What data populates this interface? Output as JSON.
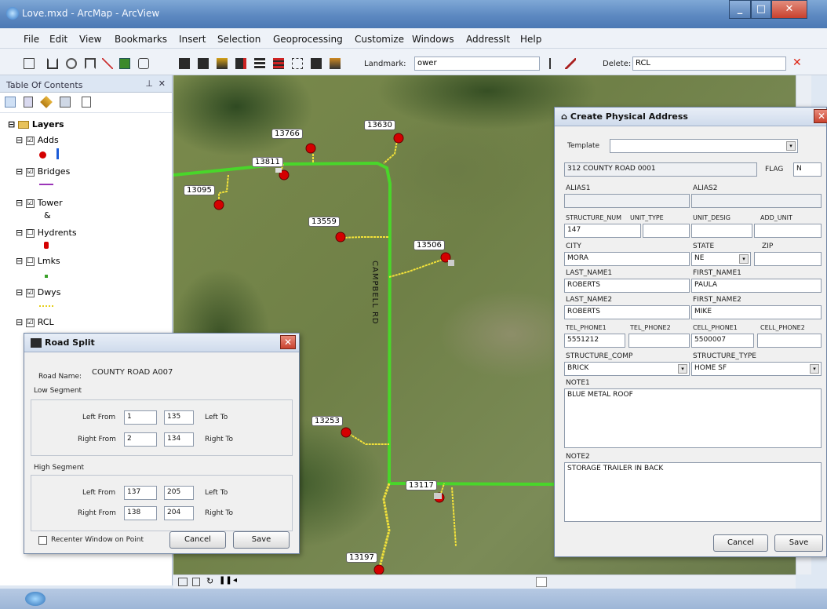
{
  "window": {
    "title": "Love.mxd - ArcMap - ArcView"
  },
  "menu": [
    "File",
    "Edit",
    "View",
    "Bookmarks",
    "Insert",
    "Selection",
    "Geoprocessing",
    "Customize",
    "Windows",
    "AddressIt",
    "Help"
  ],
  "toolbar": {
    "landmark_label": "Landmark:",
    "landmark_value": "ower",
    "delete_label": "Delete:",
    "delete_value": "RCL"
  },
  "toc": {
    "title": "Table Of Contents",
    "root": "Layers",
    "layers": [
      {
        "name": "Adds",
        "checked": "☑"
      },
      {
        "name": "Bridges",
        "checked": "☑"
      },
      {
        "name": "Tower",
        "checked": "☑"
      },
      {
        "name": "Hydrents",
        "checked": "☐"
      },
      {
        "name": "Lmks",
        "checked": "☐"
      },
      {
        "name": "Dwys",
        "checked": "☑"
      },
      {
        "name": "RCL",
        "checked": "☑"
      }
    ]
  },
  "map": {
    "labels": [
      "13766",
      "13630",
      "13811",
      "13095",
      "13559",
      "13506",
      "13253",
      "13117",
      "13197"
    ],
    "road_label": "CAMPBELL RD"
  },
  "road_split": {
    "title": "Road Split",
    "road_name_label": "Road Name:",
    "road_name_value": "COUNTY ROAD A007",
    "low_segment": "Low Segment",
    "high_segment": "High Segment",
    "left_from": "Left From",
    "right_from": "Right From",
    "left_to": "Left To",
    "right_to": "Right To",
    "low": {
      "left_from": "1",
      "left_to": "135",
      "right_from": "2",
      "right_to": "134"
    },
    "high": {
      "left_from": "137",
      "left_to": "205",
      "right_from": "138",
      "right_to": "204"
    },
    "recenter_label": "Recenter Window on Point",
    "cancel": "Cancel",
    "save": "Save"
  },
  "physical_address": {
    "title": "Create Physical Address",
    "template_label": "Template",
    "address": "312 COUNTY ROAD 0001",
    "flag_label": "FLAG",
    "flag_value": "N",
    "alias1": "ALIAS1",
    "alias2": "ALIAS2",
    "structure_num_label": "STRUCTURE_NUM",
    "unit_type_label": "UNIT_TYPE",
    "unit_desig_label": "UNIT_DESIG",
    "add_unit_label": "ADD_UNIT",
    "structure_num_value": "147",
    "city_label": "CITY",
    "state_label": "STATE",
    "zip_label": "ZIP",
    "city_value": "MORA",
    "state_value": "NE",
    "last_name1_label": "LAST_NAME1",
    "first_name1_label": "FIRST_NAME1",
    "last_name1_value": "ROBERTS",
    "first_name1_value": "PAULA",
    "last_name2_label": "LAST_NAME2",
    "first_name2_label": "FIRST_NAME2",
    "last_name2_value": "ROBERTS",
    "first_name2_value": "MIKE",
    "phone1_label": "TEL_PHONE1",
    "phone2_label": "TEL_PHONE2",
    "cell1_label": "CELL_PHONE1",
    "cell2_label": "CELL_PHONE2",
    "phone1_value": "5551212",
    "cell1_value": "5500007",
    "structure_comp_label": "STRUCTURE_COMP",
    "structure_type_label": "STRUCTURE_TYPE",
    "structure_comp_value": "BRICK",
    "structure_type_value": "HOME SF",
    "note1_label": "NOTE1",
    "note1_value": "BLUE METAL ROOF",
    "note2_label": "NOTE2",
    "note2_value": "STORAGE TRAILER IN BACK",
    "cancel": "Cancel",
    "save": "Save"
  },
  "colors": {
    "road": "#49d62a",
    "driveway": "#f3e23a",
    "point": "#d40000"
  }
}
